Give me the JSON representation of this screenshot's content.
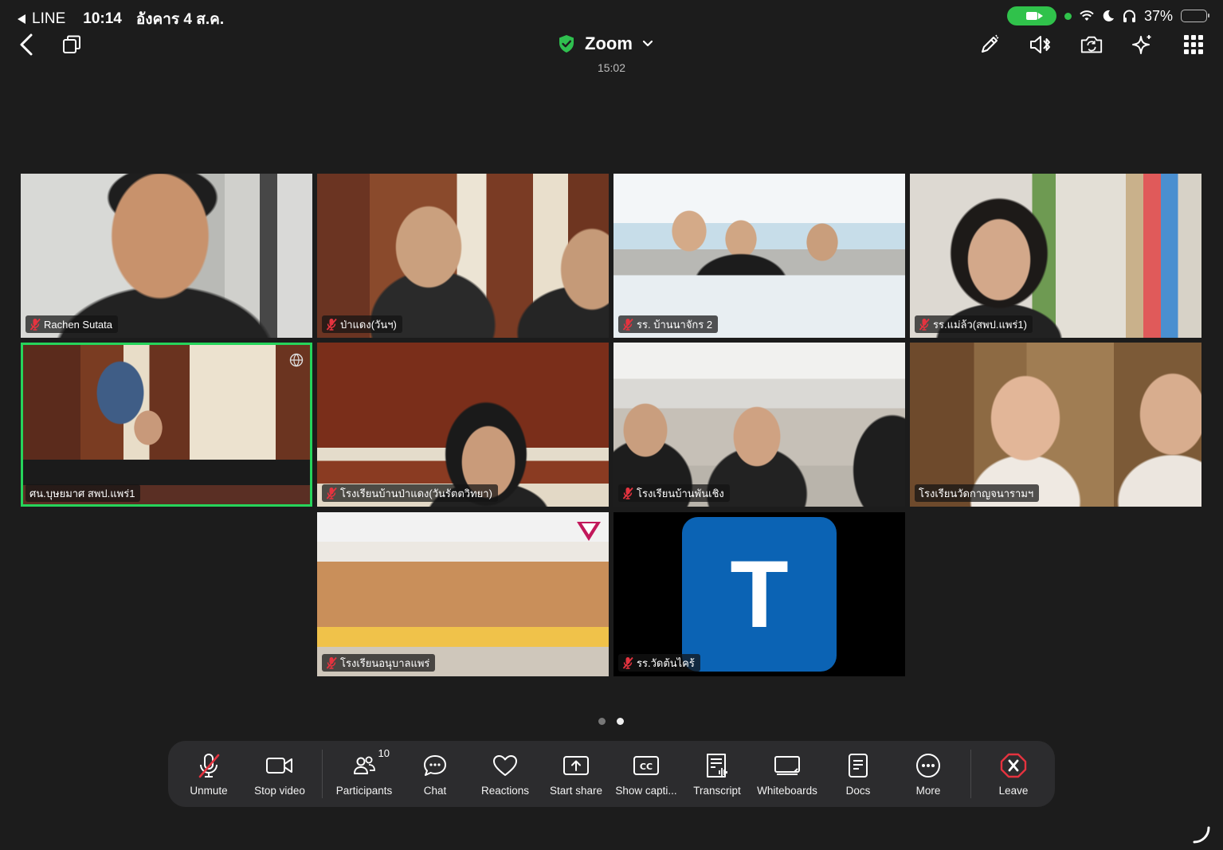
{
  "status_bar": {
    "back_app": "LINE",
    "time": "10:14",
    "date": "อังคาร 4 ส.ค.",
    "battery": "37%",
    "battery_level": 0.37
  },
  "header": {
    "title": "Zoom",
    "timer": "15:02",
    "icons": [
      "back-chevron-icon",
      "pip-icon",
      "shield-check-icon",
      "chevron-down-icon",
      "pen-icon",
      "bluetooth-speaker-icon",
      "camera-flip-icon",
      "sparkle-icon",
      "grid-icon"
    ],
    "colors": {
      "shield": "#2fbf4f"
    }
  },
  "participants": [
    {
      "name": "Rachen Sutata",
      "muted": true
    },
    {
      "name": "ป่าแดง(วันฯ)",
      "muted": true
    },
    {
      "name": "รร. บ้านนาจักร 2",
      "muted": true
    },
    {
      "name": "รร.แม่ล้ว(สพป.แพร่1)",
      "muted": true
    },
    {
      "name": "ศน.บุษยมาศ สพป.แพร่1",
      "muted": false,
      "active_speaker": true
    },
    {
      "name": "โรงเรียนบ้านป่าแดง(วันรัตตวิทยา)",
      "muted": true
    },
    {
      "name": "โรงเรียนบ้านพันเชิง",
      "muted": true
    },
    {
      "name": "โรงเรียนวัดกาญจนารามฯ",
      "muted": false
    },
    {
      "name": "โรงเรียนอนุบาลแพร่",
      "muted": true
    },
    {
      "name": "รร.วัดต้นไคร้",
      "muted": true,
      "avatar_letter": "T"
    }
  ],
  "pagination": {
    "pages": 2,
    "current": 2
  },
  "toolbar": {
    "unmute": "Unmute",
    "stop_video": "Stop video",
    "participants": "Participants",
    "participants_count": "10",
    "chat": "Chat",
    "reactions": "Reactions",
    "start_share": "Start share",
    "show_captions": "Show capti...",
    "transcript": "Transcript",
    "whiteboards": "Whiteboards",
    "docs": "Docs",
    "more": "More",
    "leave": "Leave"
  },
  "colors": {
    "active_speaker_border": "#26d45b",
    "leave": "#e5333f",
    "mute_red": "#e5333f",
    "avatar_bg": "#0b63b4"
  }
}
